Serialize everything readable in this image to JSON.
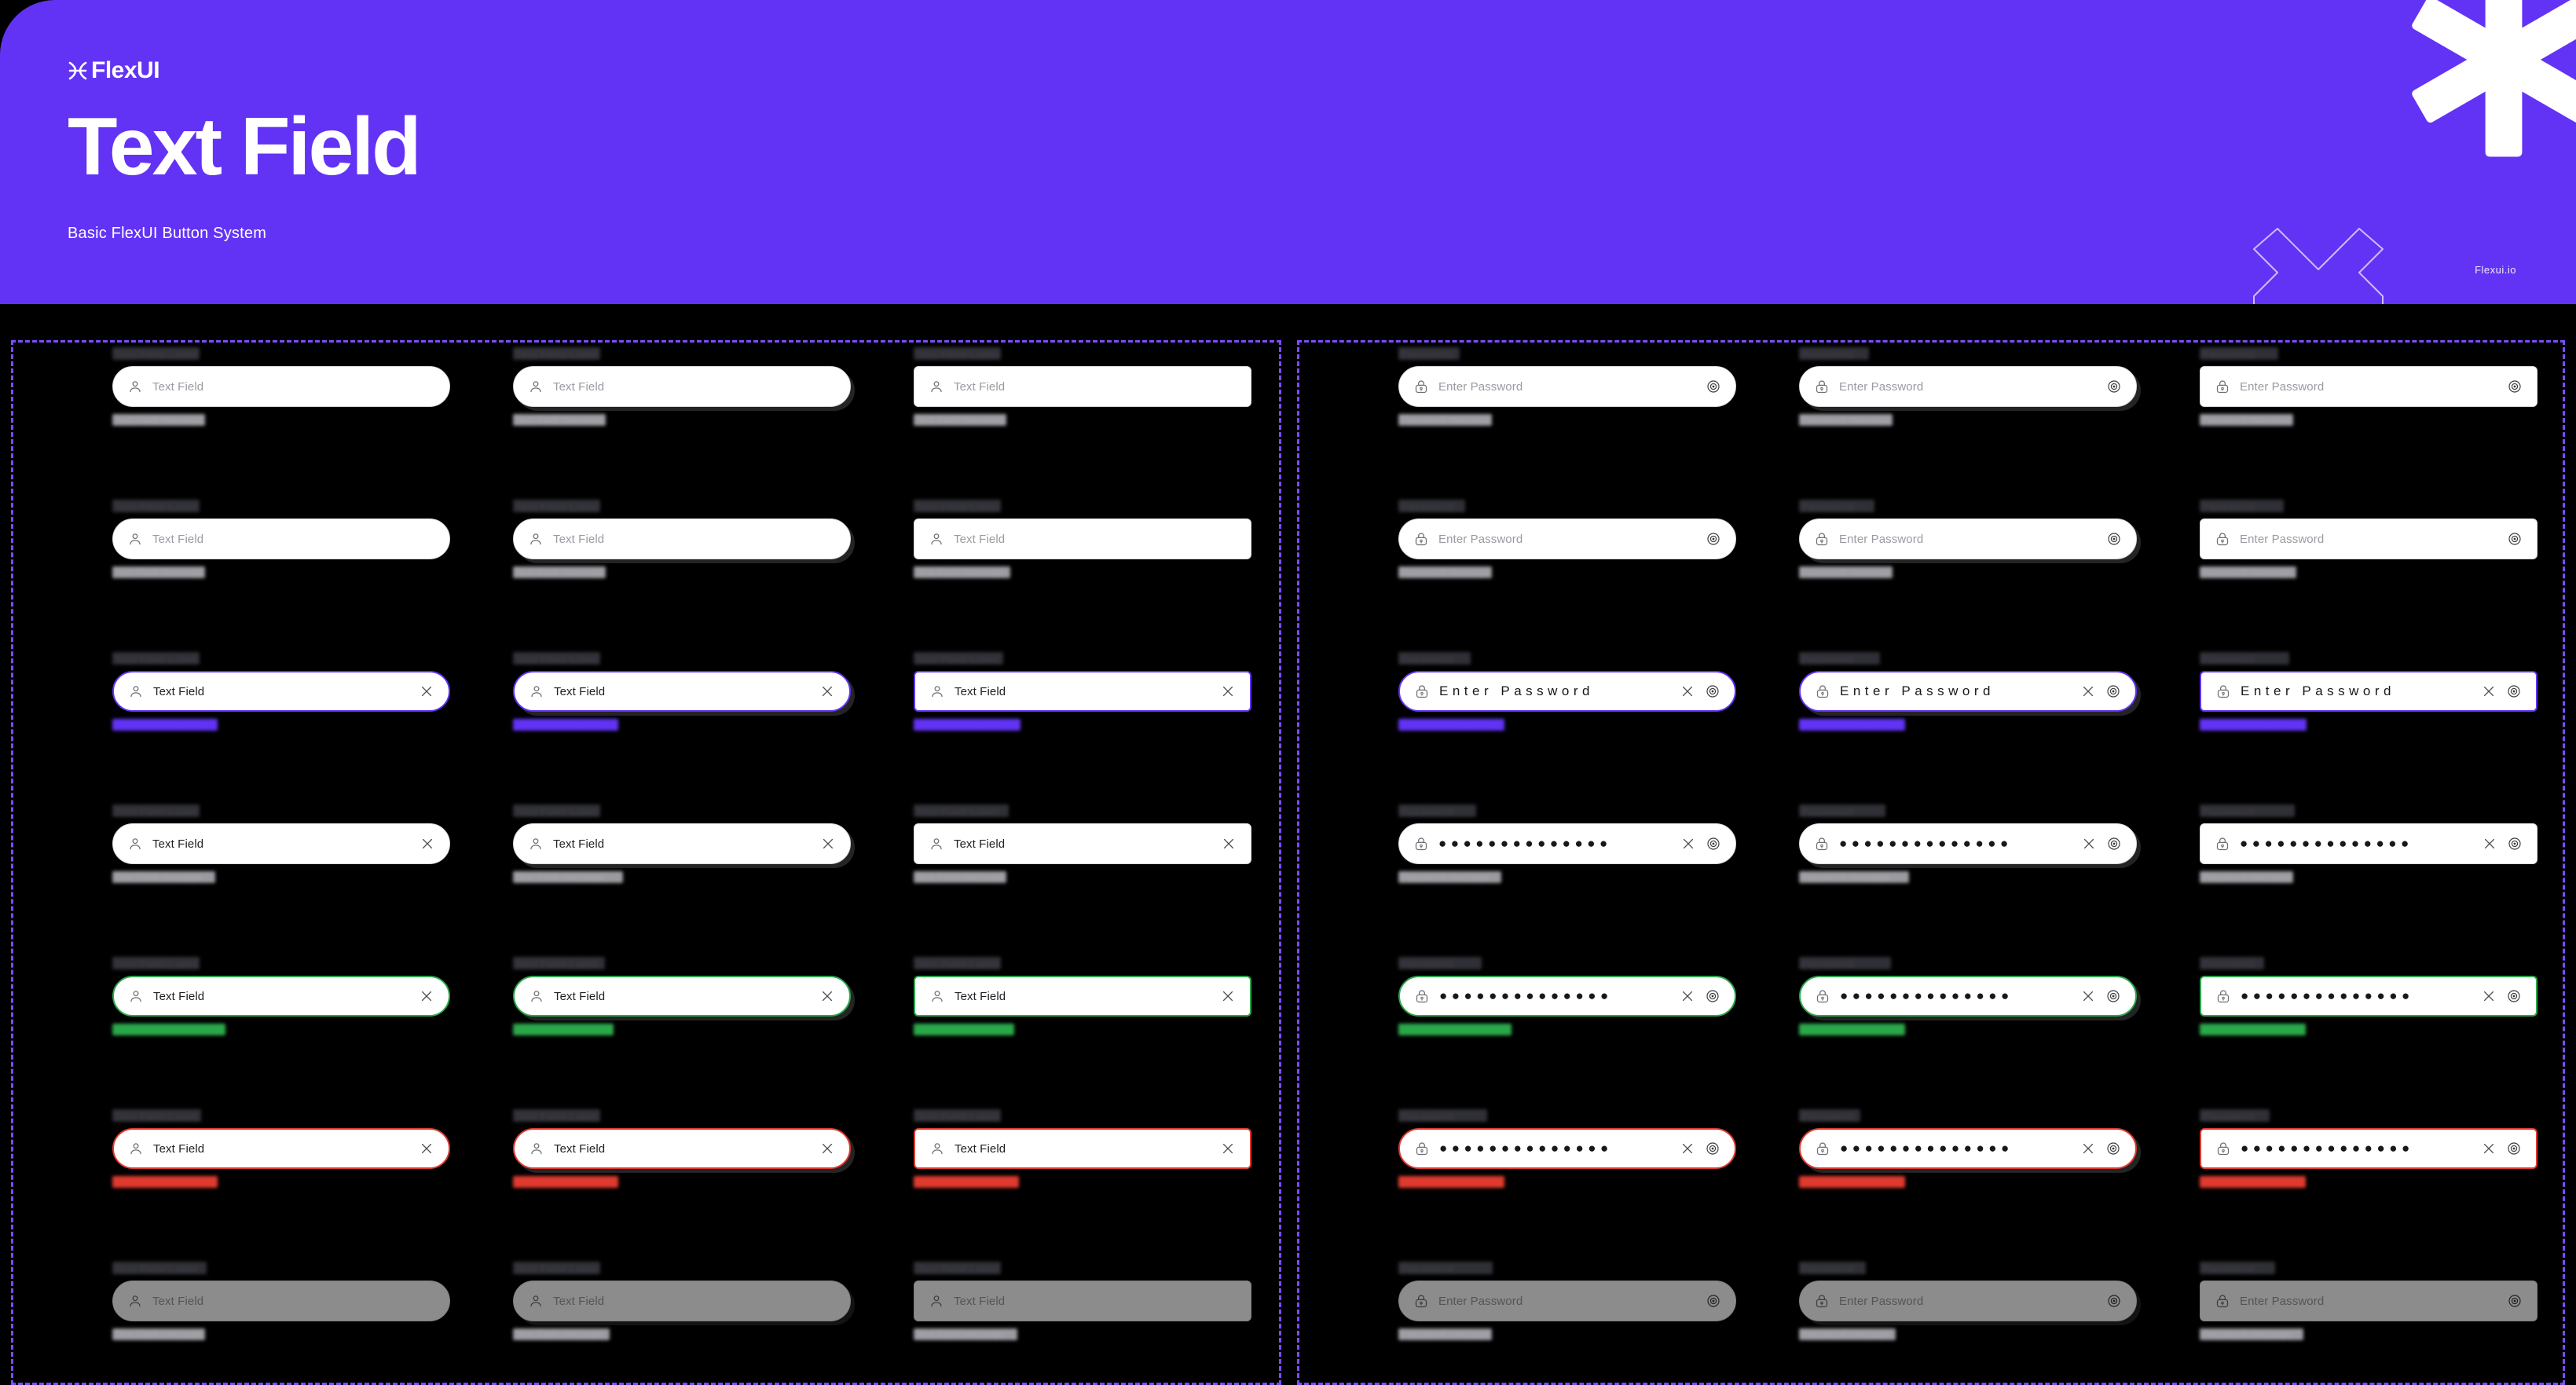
{
  "header": {
    "brand": "FlexUI",
    "brand_icon": "flexui-logo-icon",
    "title": "Text Field",
    "subtitle": "Basic FlexUI Button System",
    "url": "Flexui.io",
    "accent_purple": "#6233F5",
    "asterisk_icon": "asterisk-decoration-icon",
    "chevron_icon": "chevron-outline-decoration-icon"
  },
  "colors": {
    "accent": "#6233F5",
    "success": "#2BA84A",
    "error": "#E03A2F",
    "neutral_border": "#d9d9de",
    "panel_border": "#7C4DFF",
    "background": "#000000"
  },
  "panels": [
    {
      "name": "text-field-panel",
      "variant": "text",
      "icon": "user-icon",
      "placeholder": "Text Field",
      "value": "Text Field",
      "label": "Text Field Label",
      "help": "Text Field message"
    },
    {
      "name": "password-field-panel",
      "variant": "password",
      "icon": "lock-icon",
      "placeholder": "Enter Password",
      "value": "••••••••••••••",
      "label": "Password",
      "help": "Password message"
    }
  ],
  "columns": [
    {
      "name": "rounded",
      "shape": "pill"
    },
    {
      "name": "rounded-shadow",
      "shape": "pill-shadow"
    },
    {
      "name": "square",
      "shape": "square"
    }
  ],
  "rows": [
    {
      "state": "default",
      "label": "Text Field Label",
      "help": "Text Field message",
      "has_clear": false,
      "filled": false,
      "tone": "neutral"
    },
    {
      "state": "hover",
      "label": "Text Field Label",
      "help": "Text Field message",
      "has_clear": false,
      "filled": false,
      "tone": "neutral"
    },
    {
      "state": "focused",
      "label": "Text Field Label",
      "help": "Text Field message",
      "has_clear": true,
      "filled": true,
      "tone": "purple"
    },
    {
      "state": "filled",
      "label": "Text Field Label",
      "help": "Text Field message",
      "has_clear": true,
      "filled": true,
      "tone": "neutral"
    },
    {
      "state": "success",
      "label": "Text Field Label",
      "help": "Text Field success",
      "has_clear": true,
      "filled": true,
      "tone": "green"
    },
    {
      "state": "error",
      "label": "Text Field Label",
      "help": "Text Field message",
      "has_clear": true,
      "filled": true,
      "tone": "red"
    },
    {
      "state": "disabled",
      "label": "Text Field Label",
      "help": "Text Field message",
      "has_clear": false,
      "filled": false,
      "tone": "neutral"
    }
  ],
  "icons": {
    "user": "user-icon",
    "lock": "lock-icon",
    "clear": "close-x-icon",
    "eye": "eye-visibility-icon"
  },
  "password_dots": "●●●●●●●●●●●●●●"
}
